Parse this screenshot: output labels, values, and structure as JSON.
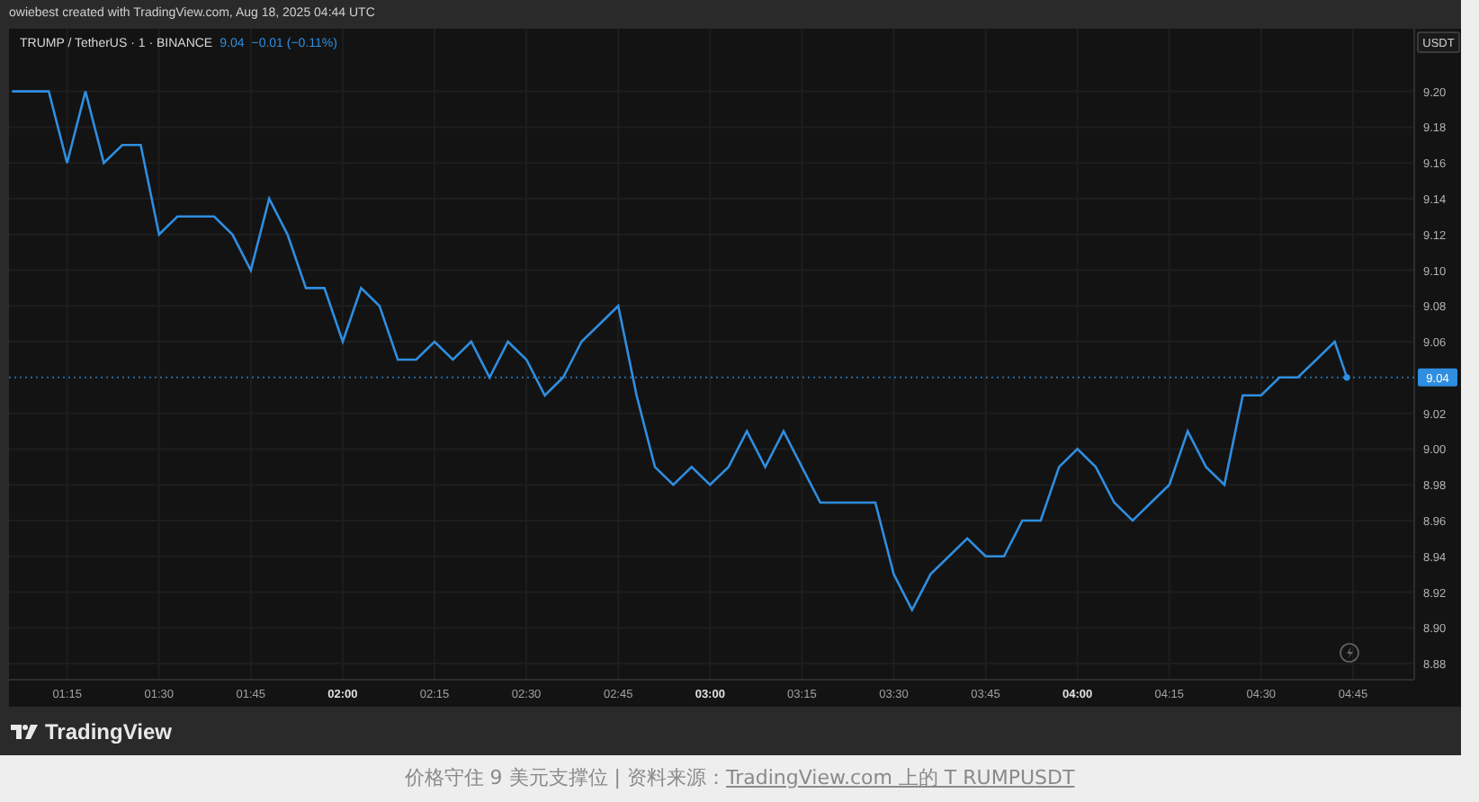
{
  "credit": "owiebest created with TradingView.com, Aug 18, 2025 04:44 UTC",
  "legend": {
    "symbol": "TRUMP / TetherUS · 1 · BINANCE",
    "price": "9.04",
    "change": "−0.01 (−0.11%)"
  },
  "price_axis": {
    "currency": "USDT",
    "last_price": "9.04"
  },
  "chart_data": {
    "type": "line",
    "xlim": [
      65.5,
      295
    ],
    "ylim": [
      8.871,
      9.235
    ],
    "x": [
      66,
      69,
      72,
      75,
      78,
      81,
      84,
      87,
      90,
      93,
      96,
      99,
      102,
      105,
      108,
      111,
      114,
      117,
      120,
      123,
      126,
      129,
      132,
      135,
      138,
      141,
      144,
      147,
      150,
      153,
      156,
      159,
      162,
      165,
      168,
      171,
      174,
      177,
      180,
      183,
      186,
      189,
      192,
      195,
      198,
      201,
      204,
      207,
      210,
      213,
      216,
      219,
      222,
      225,
      228,
      231,
      234,
      237,
      240,
      243,
      246,
      249,
      252,
      255,
      258,
      261,
      264,
      267,
      270,
      273,
      276,
      279,
      282,
      284
    ],
    "grid": true,
    "ref_lines": [
      {
        "axis": "y",
        "value": 9.04
      }
    ],
    "series": [
      {
        "color": "#2f8ee0",
        "values": [
          9.2,
          9.2,
          9.2,
          9.16,
          9.2,
          9.16,
          9.17,
          9.17,
          9.12,
          9.13,
          9.13,
          9.13,
          9.12,
          9.1,
          9.14,
          9.12,
          9.09,
          9.09,
          9.06,
          9.09,
          9.08,
          9.05,
          9.05,
          9.06,
          9.05,
          9.06,
          9.04,
          9.06,
          9.05,
          9.03,
          9.04,
          9.06,
          9.07,
          9.08,
          9.03,
          8.99,
          8.98,
          8.99,
          8.98,
          8.99,
          9.01,
          8.99,
          9.01,
          8.99,
          8.97,
          8.97,
          8.97,
          8.97,
          8.93,
          8.91,
          8.93,
          8.94,
          8.95,
          8.94,
          8.94,
          8.96,
          8.96,
          8.99,
          9.0,
          8.99,
          8.97,
          8.96,
          8.97,
          8.98,
          9.01,
          8.99,
          8.98,
          9.03,
          9.03,
          9.04,
          9.04,
          9.05,
          9.06,
          9.04
        ]
      }
    ],
    "xticks": [
      {
        "value": 75,
        "label": "01:15"
      },
      {
        "value": 90,
        "label": "01:30"
      },
      {
        "value": 105,
        "label": "01:45"
      },
      {
        "value": 120,
        "label": "02:00"
      },
      {
        "value": 135,
        "label": "02:15"
      },
      {
        "value": 150,
        "label": "02:30"
      },
      {
        "value": 165,
        "label": "02:45"
      },
      {
        "value": 180,
        "label": "03:00"
      },
      {
        "value": 195,
        "label": "03:15"
      },
      {
        "value": 210,
        "label": "03:30"
      },
      {
        "value": 225,
        "label": "03:45"
      },
      {
        "value": 240,
        "label": "04:00"
      },
      {
        "value": 255,
        "label": "04:15"
      },
      {
        "value": 270,
        "label": "04:30"
      },
      {
        "value": 285,
        "label": "04:45"
      }
    ],
    "yticks": [
      {
        "value": 8.88,
        "label": "8.88"
      },
      {
        "value": 8.9,
        "label": "8.90"
      },
      {
        "value": 8.92,
        "label": "8.92"
      },
      {
        "value": 8.94,
        "label": "8.94"
      },
      {
        "value": 8.96,
        "label": "8.96"
      },
      {
        "value": 8.98,
        "label": "8.98"
      },
      {
        "value": 9.0,
        "label": "9.00"
      },
      {
        "value": 9.02,
        "label": "9.02"
      },
      {
        "value": 9.06,
        "label": "9.06"
      },
      {
        "value": 9.08,
        "label": "9.08"
      },
      {
        "value": 9.1,
        "label": "9.10"
      },
      {
        "value": 9.12,
        "label": "9.12"
      },
      {
        "value": 9.14,
        "label": "9.14"
      },
      {
        "value": 9.16,
        "label": "9.16"
      },
      {
        "value": 9.18,
        "label": "9.18"
      },
      {
        "value": 9.2,
        "label": "9.20"
      }
    ]
  },
  "brand": "TradingView",
  "caption": {
    "text": "价格守住 9 美元支撑位 | 资料来源：",
    "link": "TradingView.com 上的 T RUMPUSDT"
  }
}
